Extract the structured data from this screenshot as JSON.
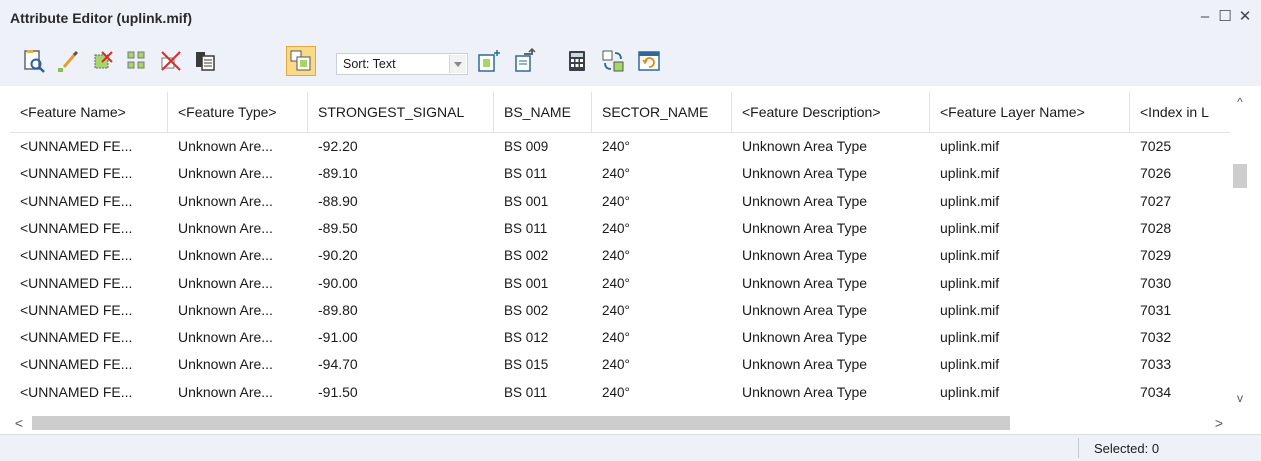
{
  "window": {
    "title": "Attribute Editor (uplink.mif)",
    "minimize_glyph": "–",
    "maximize_glyph": "☐",
    "close_glyph": "✕"
  },
  "toolbar": {
    "sort_label": "Sort: Text",
    "buttons": [
      {
        "name": "find-feature-icon"
      },
      {
        "name": "edit-pencil-icon"
      },
      {
        "name": "clear-selection-icon"
      },
      {
        "name": "select-all-icon"
      },
      {
        "name": "delete-icon"
      },
      {
        "name": "copy-records-icon"
      },
      {
        "name": "show-selected-icon",
        "active": true
      },
      {
        "name": "add-column-icon"
      },
      {
        "name": "export-icon"
      },
      {
        "name": "calculator-icon"
      },
      {
        "name": "swap-icon"
      },
      {
        "name": "refresh-window-icon"
      }
    ]
  },
  "grid": {
    "columns": [
      "<Feature Name>",
      "<Feature Type>",
      "STRONGEST_SIGNAL",
      "BS_NAME",
      "SECTOR_NAME",
      "<Feature Description>",
      "<Feature Layer Name>",
      "<Index in L"
    ],
    "rows": [
      [
        "<UNNAMED FE...",
        "Unknown Are...",
        "-92.20",
        "BS 009",
        "240°",
        "Unknown Area Type",
        "uplink.mif",
        "7025"
      ],
      [
        "<UNNAMED FE...",
        "Unknown Are...",
        "-89.10",
        "BS 011",
        "240°",
        "Unknown Area Type",
        "uplink.mif",
        "7026"
      ],
      [
        "<UNNAMED FE...",
        "Unknown Are...",
        "-88.90",
        "BS 001",
        "240°",
        "Unknown Area Type",
        "uplink.mif",
        "7027"
      ],
      [
        "<UNNAMED FE...",
        "Unknown Are...",
        "-89.50",
        "BS 011",
        "240°",
        "Unknown Area Type",
        "uplink.mif",
        "7028"
      ],
      [
        "<UNNAMED FE...",
        "Unknown Are...",
        "-90.20",
        "BS 002",
        "240°",
        "Unknown Area Type",
        "uplink.mif",
        "7029"
      ],
      [
        "<UNNAMED FE...",
        "Unknown Are...",
        "-90.00",
        "BS 001",
        "240°",
        "Unknown Area Type",
        "uplink.mif",
        "7030"
      ],
      [
        "<UNNAMED FE...",
        "Unknown Are...",
        "-89.80",
        "BS 002",
        "240°",
        "Unknown Area Type",
        "uplink.mif",
        "7031"
      ],
      [
        "<UNNAMED FE...",
        "Unknown Are...",
        "-91.00",
        "BS 012",
        "240°",
        "Unknown Area Type",
        "uplink.mif",
        "7032"
      ],
      [
        "<UNNAMED FE...",
        "Unknown Are...",
        "-94.70",
        "BS 015",
        "240°",
        "Unknown Area Type",
        "uplink.mif",
        "7033"
      ],
      [
        "<UNNAMED FE...",
        "Unknown Are...",
        "-91.50",
        "BS 011",
        "240°",
        "Unknown Area Type",
        "uplink.mif",
        "7034"
      ]
    ]
  },
  "scrollbars": {
    "up_glyph": "^",
    "down_glyph": "v",
    "left_glyph": "<",
    "right_glyph": ">"
  },
  "status": {
    "selected": "Selected: 0"
  }
}
